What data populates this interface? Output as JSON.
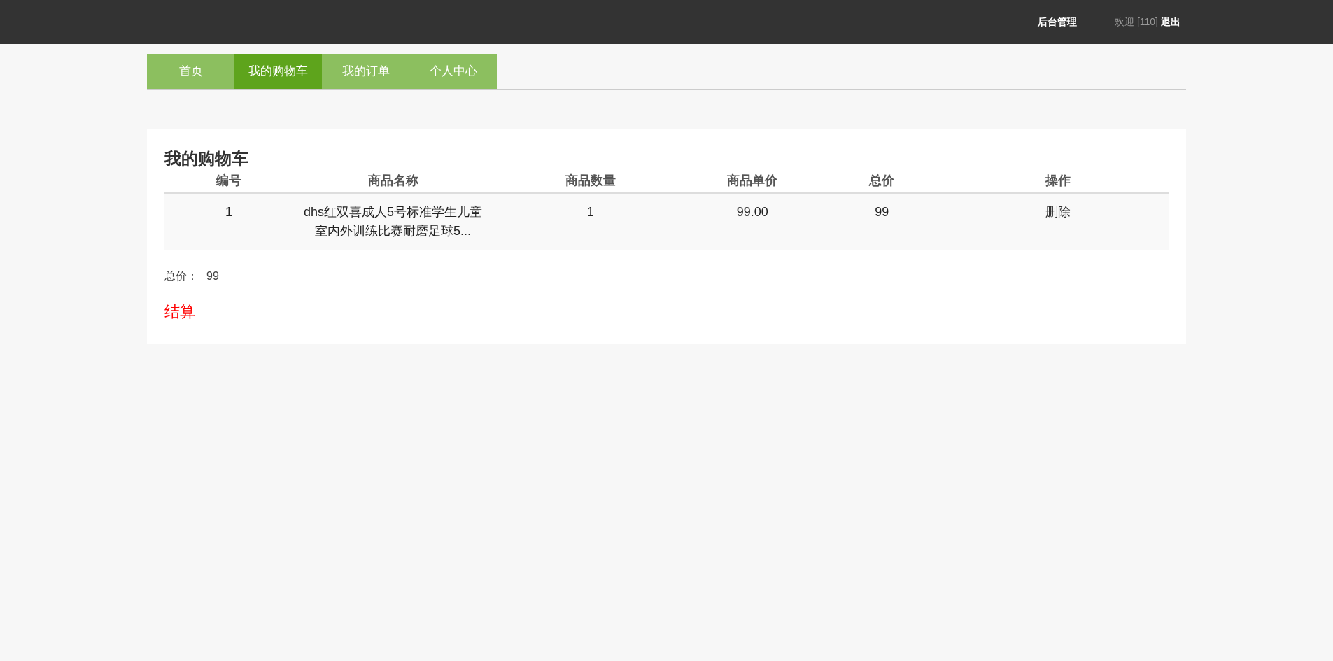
{
  "topbar": {
    "admin_link": "后台管理",
    "greeting": "欢迎 [110]",
    "logout": "退出"
  },
  "tabs": [
    {
      "label": "首页",
      "selected": false
    },
    {
      "label": "我的购物车",
      "selected": true
    },
    {
      "label": "我的订单",
      "selected": false
    },
    {
      "label": "个人中心",
      "selected": false
    }
  ],
  "cart": {
    "title": "我的购物车",
    "columns": [
      "编号",
      "商品名称",
      "商品数量",
      "商品单价",
      "总价",
      "操作"
    ],
    "rows": [
      {
        "id": "1",
        "name": "dhs红双喜成人5号标准学生儿童室内外训练比赛耐磨足球5...",
        "quantity": "1",
        "unit_price": "99.00",
        "total": "99",
        "action": "删除"
      }
    ],
    "total_label": "总价：",
    "total_value": "99",
    "checkout": "结算"
  }
}
